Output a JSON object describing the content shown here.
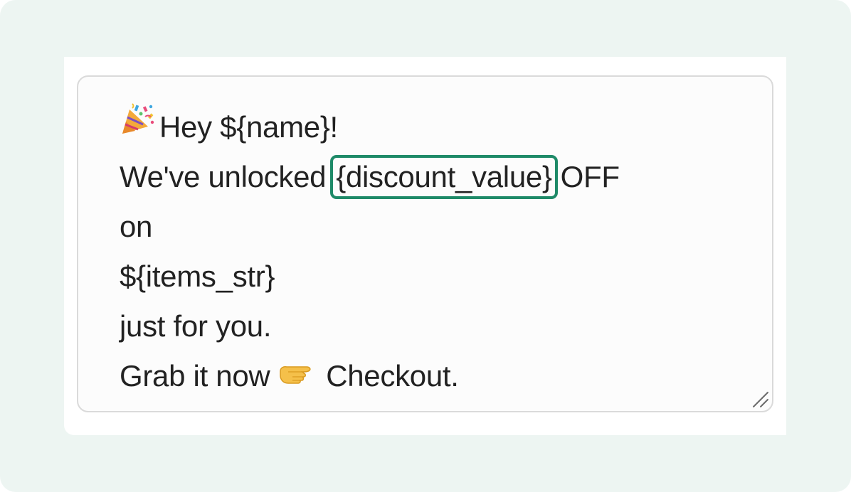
{
  "message": {
    "greeting_prefix": "Hey",
    "greeting_var": "${name}!",
    "line2_prefix": "We've unlocked",
    "highlighted_var": "{discount_value}",
    "line2_suffix": "OFF",
    "line3": "on",
    "line4": "${items_str}",
    "line5": "just for you.",
    "line6_prefix": "Grab it now",
    "line6_suffix": "Checkout."
  },
  "icons": {
    "greeting": "party-popper-icon",
    "cta": "pointing-hand-icon",
    "resize": "resize-handle-icon"
  },
  "colors": {
    "highlight_border": "#1e8a68",
    "background": "#edf5f2",
    "text": "#222222"
  }
}
